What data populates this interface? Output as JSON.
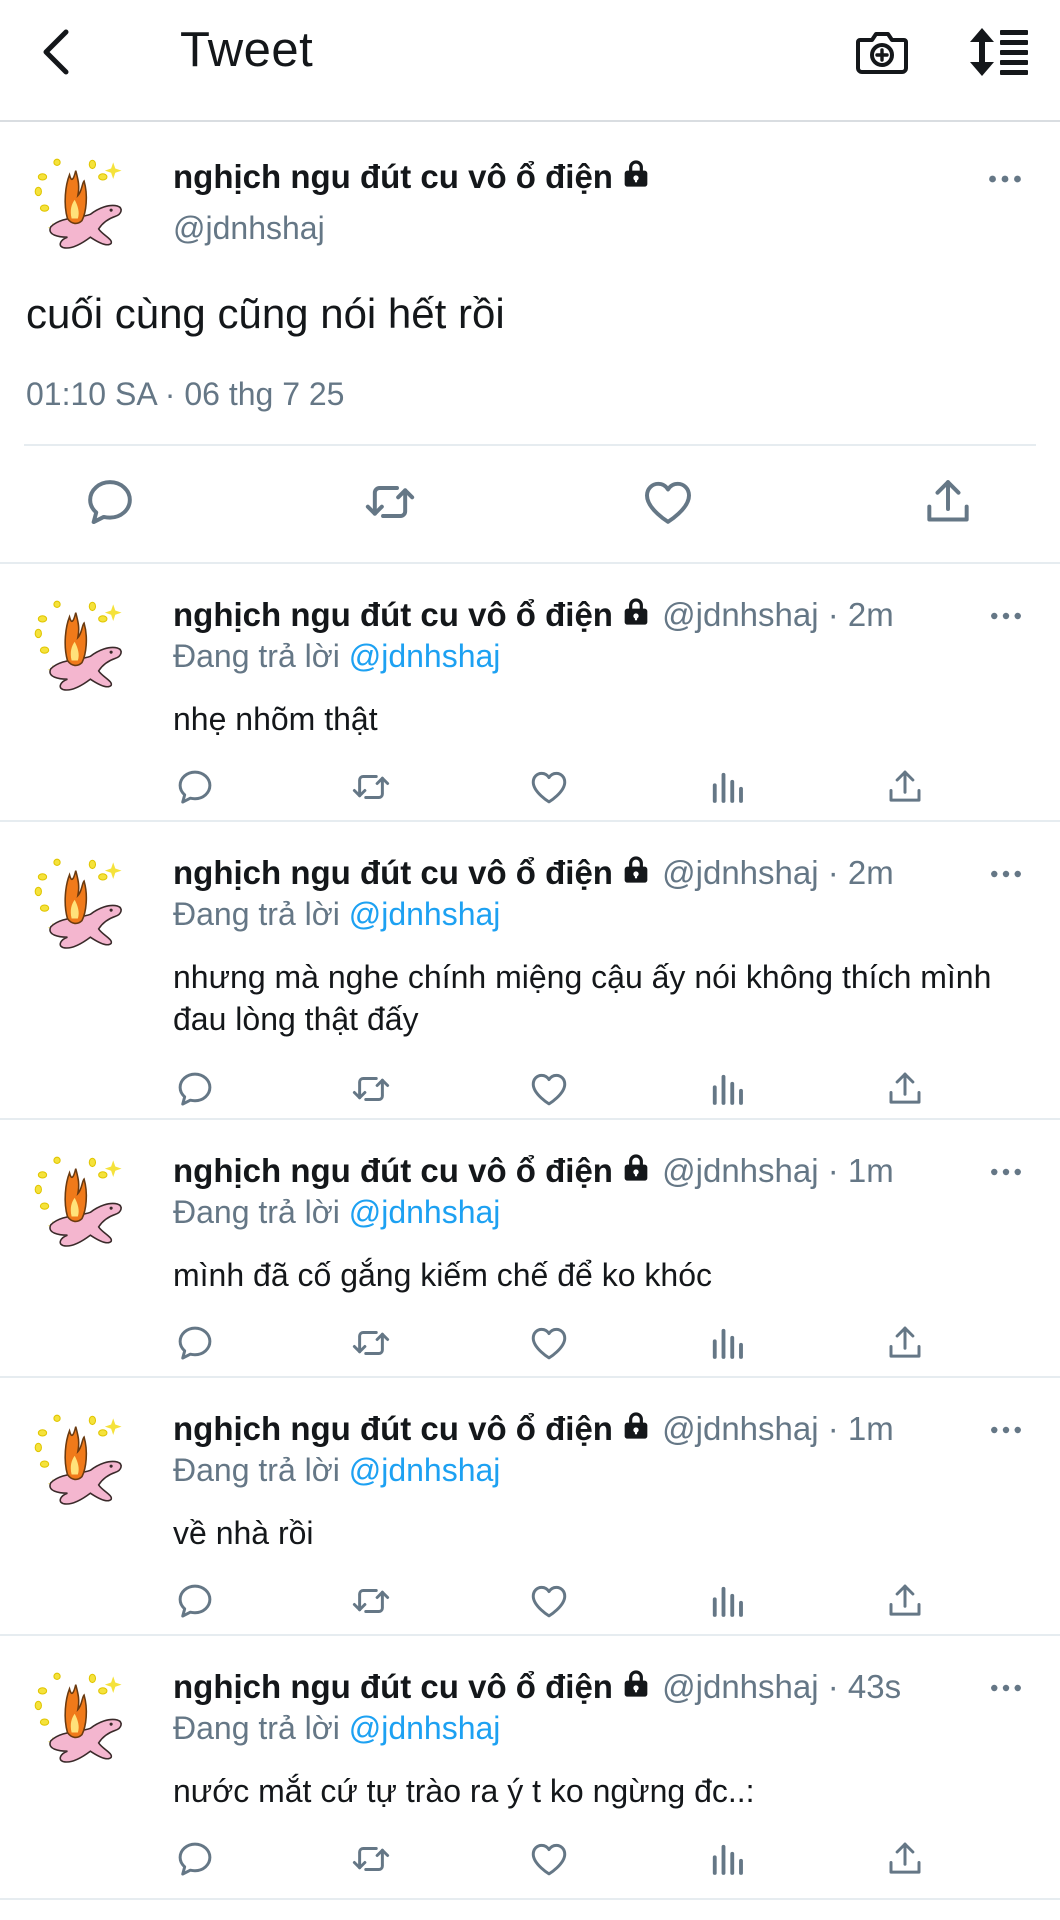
{
  "header": {
    "title": "Tweet",
    "back_icon": "chevron-left-icon",
    "camera_icon": "camera-plus-icon",
    "sort_icon": "sort-list-icon"
  },
  "colors": {
    "link": "#1da1f2",
    "secondary": "#657786",
    "text": "#14171a",
    "divider": "#e6ecf0"
  },
  "main_tweet": {
    "name": "nghịch ngu đút cu vô ổ điện",
    "handle": "@jdnhshaj",
    "text": "cuối cùng cũng nói hết rồi",
    "timestamp": "01:10 SA · 06 thg 7 25",
    "actions": [
      "reply-icon",
      "retweet-icon",
      "like-icon",
      "share-icon"
    ]
  },
  "replies": [
    {
      "name": "nghịch ngu đút cu vô ổ điện",
      "meta": "@jdnhshaj · 2m",
      "replying_prefix": "Đang trả lời",
      "replying_to": "@jdnhshaj",
      "text": "nhẹ nhõm thật"
    },
    {
      "name": "nghịch ngu đút cu vô ổ điện",
      "meta": "@jdnhshaj · 2m",
      "replying_prefix": "Đang trả lời",
      "replying_to": "@jdnhshaj",
      "text": "nhưng mà nghe chính miệng cậu ấy nói không thích mình đau lòng thật đấy"
    },
    {
      "name": "nghịch ngu đút cu vô ổ điện",
      "meta": "@jdnhshaj · 1m",
      "replying_prefix": "Đang trả lời",
      "replying_to": "@jdnhshaj",
      "text": "mình đã cố gắng kiếm chế để ko khóc"
    },
    {
      "name": "nghịch ngu đút cu vô ổ điện",
      "meta": "@jdnhshaj · 1m",
      "replying_prefix": "Đang trả lời",
      "replying_to": "@jdnhshaj",
      "text": "về nhà rồi"
    },
    {
      "name": "nghịch ngu đút cu vô ổ điện",
      "meta": "@jdnhshaj · 43s",
      "replying_prefix": "Đang trả lời",
      "replying_to": "@jdnhshaj",
      "text": "nước mắt cứ tự trào ra ý t ko ngừng đc..:"
    }
  ]
}
